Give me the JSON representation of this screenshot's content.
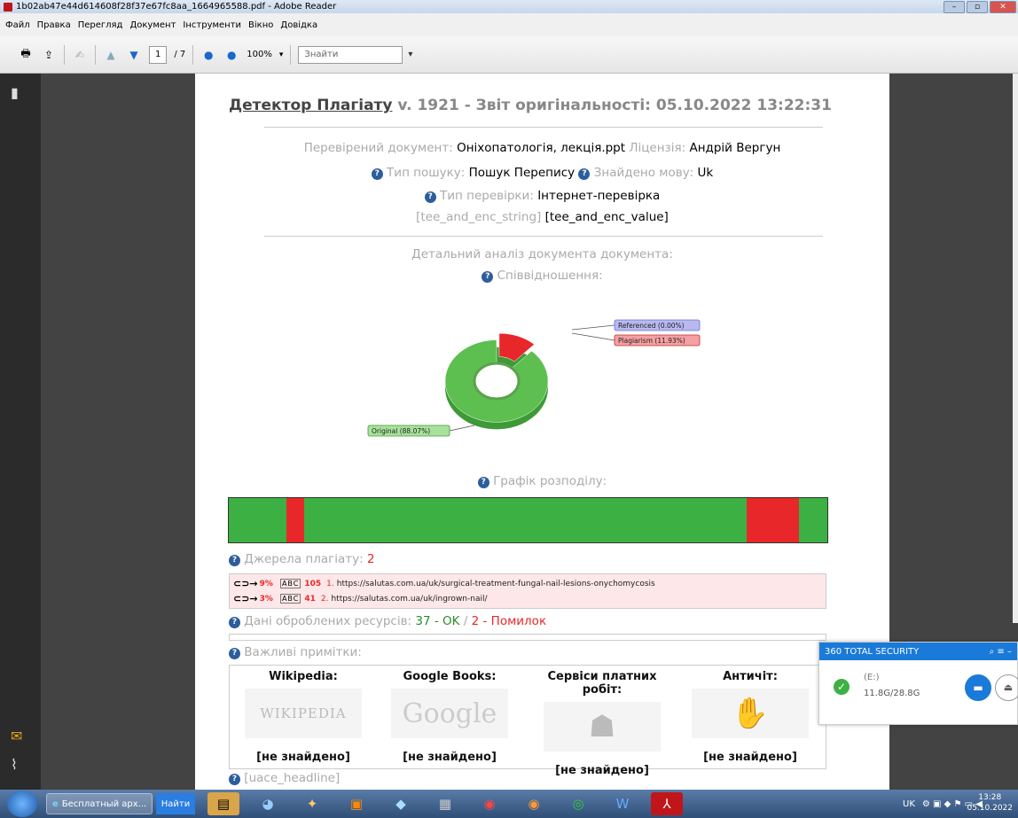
{
  "window": {
    "title": "1b02ab47e44d614608f28f37e67fc8aa_1664965588.pdf - Adobe Reader"
  },
  "menu": [
    "Файл",
    "Правка",
    "Перегляд",
    "Документ",
    "Інструменти",
    "Вікно",
    "Довідка"
  ],
  "toolbar": {
    "page_current": "1",
    "page_total": "/ 7",
    "zoom": "100%",
    "search_placeholder": "Знайти"
  },
  "report": {
    "title_brand": "Детектор Плагіату",
    "title_rest": " v. 1921 - Звіт оригінальності: 05.10.2022 13:22:31",
    "checked_doc_label": "Перевірений документ: ",
    "checked_doc_value": "Оніхопатологія, лекція.ppt",
    "license_label": " Ліцензія: ",
    "license_value": "Андрій Вергун",
    "search_type_label": "Тип пошуку: ",
    "search_type_value": "Пошук Перепису",
    "lang_label": "Знайдено мову: ",
    "lang_value": "Uk",
    "check_type_label": "Тип перевірки: ",
    "check_type_value": "Інтернет-перевірка",
    "tee_label": "[tee_and_enc_string] ",
    "tee_value": "[tee_and_enc_value]",
    "detail_heading": "Детальний аналіз документа документа:",
    "ratio_heading": "Співвідношення:",
    "dist_heading": "Графік розподілу:",
    "sources_label": "Джерела плагіату: ",
    "sources_count": "2",
    "resources_label": "Дані оброблених ресурсів: ",
    "resources_ok": "37 - OK",
    "resources_sep": " / ",
    "resources_err": "2 - Помилок",
    "notes_heading": "Важливі примітки:",
    "uace_heading": "[uace_headline]"
  },
  "chart_data": {
    "type": "pie",
    "labels": [
      "Referenced (0.00%)",
      "Plagiarism (11.93%)",
      "Original (88.07%)"
    ],
    "values": [
      0.0,
      11.93,
      88.07
    ],
    "colors": [
      "#8a8fdc",
      "#e8272a",
      "#5cbf4f"
    ]
  },
  "distribution": {
    "segments_pct": [
      {
        "start": 9.6,
        "width": 3.0
      },
      {
        "start": 86.5,
        "width": 8.8
      }
    ]
  },
  "sources": [
    {
      "pct": "9%",
      "count": "105",
      "idx": "1.",
      "url": "https://salutas.com.ua/uk/surgical-treatment-fungal-nail-lesions-onychomycosis"
    },
    {
      "pct": "3%",
      "count": "41",
      "idx": "2.",
      "url": "https://salutas.com.ua/uk/ingrown-nail/"
    }
  ],
  "notes": [
    {
      "title": "Wikipedia:",
      "logo": "WIKIPEDIA",
      "result": "[не знайдено]"
    },
    {
      "title": "Google Books:",
      "logo": "Google",
      "result": "[не знайдено]"
    },
    {
      "title": "Сервіси платних робіт:",
      "logo": "",
      "result": "[не знайдено]"
    },
    {
      "title": "Античіт:",
      "logo": "",
      "result": "[не знайдено]"
    }
  ],
  "security": {
    "title": "360 TOTAL SECURITY",
    "drive": "(E:)",
    "size": "11.8G/28.8G"
  },
  "taskbar": {
    "ie_label": "Бесплатный арх...",
    "find_label": "Найти",
    "lang": "UK",
    "time": "13:28",
    "date": "05.10.2022"
  }
}
